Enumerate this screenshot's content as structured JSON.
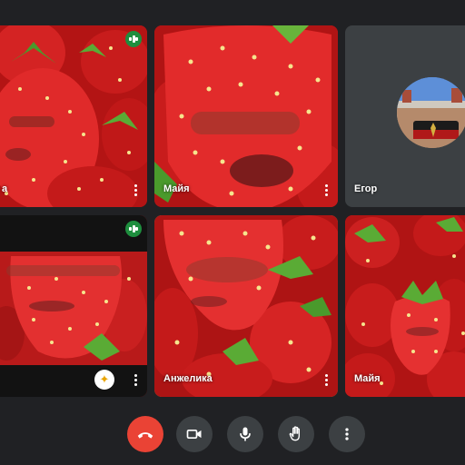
{
  "participants": [
    {
      "name": "а",
      "speaking": true
    },
    {
      "name": "Майя",
      "speaking": false
    },
    {
      "name": "Егор",
      "speaking": false
    },
    {
      "name": "",
      "speaking": true
    },
    {
      "name": "Анжелика",
      "speaking": false,
      "active": true
    },
    {
      "name": "Майя",
      "speaking": false
    }
  ],
  "controls": {
    "end_call": "end-call",
    "camera": "camera",
    "microphone": "microphone",
    "raise_hand": "raise-hand",
    "more_options": "more-options"
  },
  "colors": {
    "background": "#202124",
    "tile_dark": "#3c4043",
    "end_call": "#ea4335",
    "active_outline": "#38ad5a",
    "speaking": "#1e8e3e",
    "strawberry": "#d81f1f"
  }
}
